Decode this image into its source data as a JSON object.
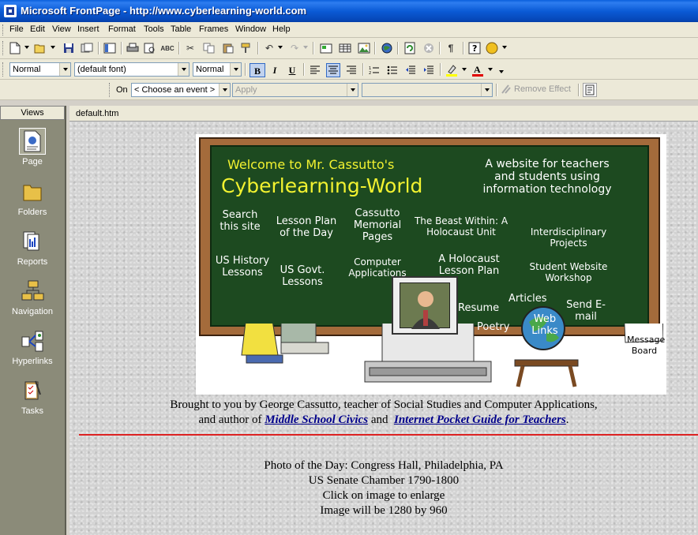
{
  "window": {
    "title": "Microsoft FrontPage - http://www.cyberlearning-world.com"
  },
  "menu": [
    "File",
    "Edit",
    "View",
    "Insert",
    "Format",
    "Tools",
    "Table",
    "Frames",
    "Window",
    "Help"
  ],
  "format_toolbar": {
    "style_value": "Normal",
    "font_value": "(default font)",
    "size_value": "Normal",
    "bold": "B",
    "italic": "I",
    "underline": "U"
  },
  "dhtml_toolbar": {
    "on_label": "On",
    "event_value": "< Choose an event >",
    "apply_label": "Apply",
    "remove_effect_label": "Remove Effect"
  },
  "views": {
    "header": "Views",
    "items": [
      {
        "label": "Page",
        "icon": "page-icon"
      },
      {
        "label": "Folders",
        "icon": "folders-icon"
      },
      {
        "label": "Reports",
        "icon": "reports-icon"
      },
      {
        "label": "Navigation",
        "icon": "navigation-icon"
      },
      {
        "label": "Hyperlinks",
        "icon": "hyperlinks-icon"
      },
      {
        "label": "Tasks",
        "icon": "tasks-icon"
      }
    ]
  },
  "document": {
    "tab": "default.htm"
  },
  "board": {
    "welcome": "Welcome to  Mr. Cassutto's",
    "site_name": "Cyberlearning-World",
    "tagline": [
      "A website for teachers",
      "and students using",
      "information technology"
    ],
    "links": [
      "Search this site",
      "Lesson Plan of the Day",
      "Cassutto Memorial Pages",
      "The Beast Within: A Holocaust Unit",
      "Interdisciplinary Projects",
      "US History Lessons",
      "US Govt. Lessons",
      "Computer Applications",
      "A Holocaust Lesson Plan",
      "Student Website Workshop",
      "Resume",
      "Articles",
      "Send E-mail",
      "Poetry",
      "Web Links",
      "Message Board"
    ]
  },
  "caption": {
    "line1": "Brought to you by George Cassutto, teacher of Social Studies and Computer Applications,",
    "line2_prefix": "and author of ",
    "link1": "Middle School Civics",
    "line2_mid": " and ",
    "link2": "Internet Pocket Guide for Teachers",
    "line2_suffix": "."
  },
  "photo": {
    "line1": "Photo of the Day: Congress Hall, Philadelphia, PA",
    "line2": "US Senate Chamber 1790-1800",
    "line3": "Click on image to enlarge",
    "line4": "Image will be 1280 by 960"
  }
}
